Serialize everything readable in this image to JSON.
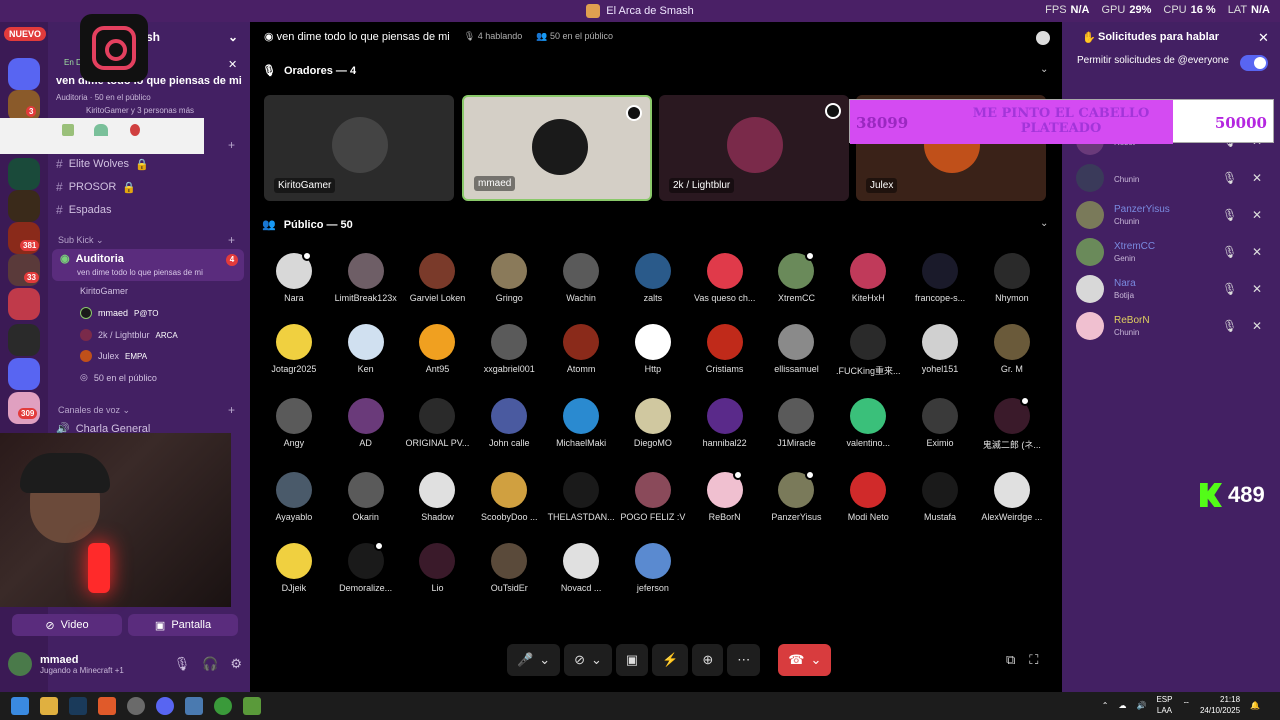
{
  "window": {
    "title": "El Arca de Smash"
  },
  "stats": [
    {
      "label": "FPS",
      "value": "N/A"
    },
    {
      "label": "GPU",
      "value": "29%"
    },
    {
      "label": "CPU",
      "value": "16 %"
    },
    {
      "label": "LAT",
      "value": "N/A"
    }
  ],
  "rail": {
    "new_badge": "NUEVO",
    "counts": [
      "3",
      "381",
      "33",
      "309"
    ]
  },
  "sidebar": {
    "server_name": "sh",
    "event": {
      "tag": "En D",
      "title": "ven dime todo lo que piensas de mi",
      "meta_channel": "Auditoria",
      "meta_count": "50 en el público",
      "meta_people": "KiritoGamer y 3 personas más"
    },
    "channels_top": [
      {
        "label": "Elite Wolves"
      },
      {
        "label": "PROSOR"
      },
      {
        "label": "Espadas"
      }
    ],
    "category_subkick": "Sub Kick",
    "active_channel": {
      "label": "Auditoria",
      "topic": "ven dime todo lo que piensas de mi",
      "badge": "4"
    },
    "members": [
      {
        "name": "KiritoGamer"
      },
      {
        "name": "mmaed",
        "tag": "P@TO"
      },
      {
        "name": "2k / Lightblur",
        "tag": "ARCA"
      },
      {
        "name": "Julex",
        "tag": "EMPA"
      },
      {
        "name": "50 en el público"
      }
    ],
    "category_voice": "Canales de voz",
    "voice_channel": "Charla General",
    "buttons": {
      "video": "Video",
      "screen": "Pantalla"
    },
    "user": {
      "name": "mmaed",
      "status": "Jugando a Minecraft +1"
    }
  },
  "stage": {
    "topic": "ven dime todo lo que piensas de mi",
    "speaking": "4 hablando",
    "audience_count": "50 en el público",
    "speakers_title": "Oradores — 4",
    "speakers": [
      {
        "name": "KiritoGamer",
        "color": "#2b2b2b",
        "avatar": "#444"
      },
      {
        "name": "mmaed",
        "color": "#d4cfc6",
        "avatar": "#1a1a1a"
      },
      {
        "name": "2k / Lightblur",
        "color": "#2a1820",
        "avatar": "#7a2a4a"
      },
      {
        "name": "Julex",
        "color": "#3a2218",
        "avatar": "#c0501a"
      }
    ],
    "audience_title": "Público — 50",
    "audience": [
      {
        "name": "Nara",
        "color": "#d8d8d8",
        "dot": true
      },
      {
        "name": "LimitBreak123x",
        "color": "#6e5e66"
      },
      {
        "name": "Garviel Loken",
        "color": "#7a3a2a"
      },
      {
        "name": "Gringo",
        "color": "#8a7a5a"
      },
      {
        "name": "Wachin",
        "color": "#5a5a5a"
      },
      {
        "name": "zalts",
        "color": "#2a5a8a"
      },
      {
        "name": "Vas queso ch...",
        "color": "#e03a4a"
      },
      {
        "name": "XtremCC",
        "color": "#6a8a5a",
        "dot": true
      },
      {
        "name": "KiteHxH",
        "color": "#c03a5a"
      },
      {
        "name": "francope-s...",
        "color": "#1a1a2a"
      },
      {
        "name": "Nhymon",
        "color": "#2a2a2a"
      },
      {
        "name": "Jotagr2025",
        "color": "#f0d040"
      },
      {
        "name": "Ken",
        "color": "#d0e0f0"
      },
      {
        "name": "Ant95",
        "color": "#f0a020"
      },
      {
        "name": "xxgabriel001",
        "color": "#5a5a5a"
      },
      {
        "name": "Atomm",
        "color": "#8a2a1a"
      },
      {
        "name": "Http",
        "color": "#ffffff"
      },
      {
        "name": "Cristiams",
        "color": "#c02a1a"
      },
      {
        "name": "ellissamuel",
        "color": "#8a8a8a"
      },
      {
        "name": ".FUCKing重来...",
        "color": "#2a2a2a"
      },
      {
        "name": "yohel151",
        "color": "#d0d0d0"
      },
      {
        "name": "Gr. M",
        "color": "#6a5a3a"
      },
      {
        "name": "Angy",
        "color": "#5a5a5a"
      },
      {
        "name": "AD",
        "color": "#6a3a7a"
      },
      {
        "name": "ORIGINAL PV...",
        "color": "#2a2a2a"
      },
      {
        "name": "John calle",
        "color": "#4a5aa0"
      },
      {
        "name": "MichaelMaki",
        "color": "#2a8ad0"
      },
      {
        "name": "DiegoMO",
        "color": "#d0c8a0"
      },
      {
        "name": "hannibal22",
        "color": "#5a2a8a"
      },
      {
        "name": "J1Miracle",
        "color": "#5a5a5a"
      },
      {
        "name": "valentino...",
        "color": "#3ac07a"
      },
      {
        "name": "Eximio",
        "color": "#3a3a3a"
      },
      {
        "name": "鬼滅二郎 (ネ...",
        "color": "#3a1a2a",
        "dot": true
      },
      {
        "name": "Ayayablo",
        "color": "#4a5a6a"
      },
      {
        "name": "Okarin",
        "color": "#5a5a5a"
      },
      {
        "name": "Shadow",
        "color": "#e0e0e0"
      },
      {
        "name": "ScoobyDoo ...",
        "color": "#d0a040"
      },
      {
        "name": "THELASTDAN...",
        "color": "#1a1a1a"
      },
      {
        "name": "POGO FELIZ :V",
        "color": "#8a4a5a"
      },
      {
        "name": "ReBorN",
        "color": "#f0c0d0",
        "dot": true
      },
      {
        "name": "PanzerYisus",
        "color": "#7a7a5a",
        "dot": true
      },
      {
        "name": "Modi Neto",
        "color": "#d02a2a"
      },
      {
        "name": "Mustafa",
        "color": "#1a1a1a"
      },
      {
        "name": "AlexWeirdge ...",
        "color": "#e0e0e0"
      },
      {
        "name": "DJjeik",
        "color": "#f0d040"
      },
      {
        "name": "Demoralize...",
        "color": "#1a1a1a",
        "dot": true
      },
      {
        "name": "Lio",
        "color": "#3a1a2a"
      },
      {
        "name": "OuTsidEr",
        "color": "#5a4a3a"
      },
      {
        "name": "Novacd ...",
        "color": "#e0e0e0"
      },
      {
        "name": "jeferson",
        "color": "#5a8ad0"
      }
    ]
  },
  "right_panel": {
    "title": "Solicitudes para hablar",
    "permission": "Permitir solicitudes de @everyone",
    "requests": [
      {
        "name": "",
        "role": "Reset",
        "color": "#6a3a7a"
      },
      {
        "name": "",
        "role": "Chunin",
        "color": "#3a3a5a"
      },
      {
        "name": "PanzerYisus",
        "role": "Chunin",
        "color": "#7a7a5a"
      },
      {
        "name": "XtremCC",
        "role": "Genin",
        "color": "#6a8a5a"
      },
      {
        "name": "Nara",
        "role": "Botija",
        "color": "#d8d8d8"
      },
      {
        "name": "ReBorN",
        "role": "Chunin",
        "color": "#f0c0d0"
      }
    ]
  },
  "goal": {
    "current": "38099",
    "text": "ME PINTO EL CABELLO PLATEADO",
    "target": "50000",
    "progress": 0.76
  },
  "kick": {
    "count": "489"
  },
  "taskbar": {
    "lang1": "ESP",
    "lang2": "LAA",
    "time": "21:18",
    "date": "24/10/2025"
  },
  "controls": {
    "mic": "🎤",
    "cam": "📷",
    "screen": "🖥",
    "end": "📞"
  }
}
